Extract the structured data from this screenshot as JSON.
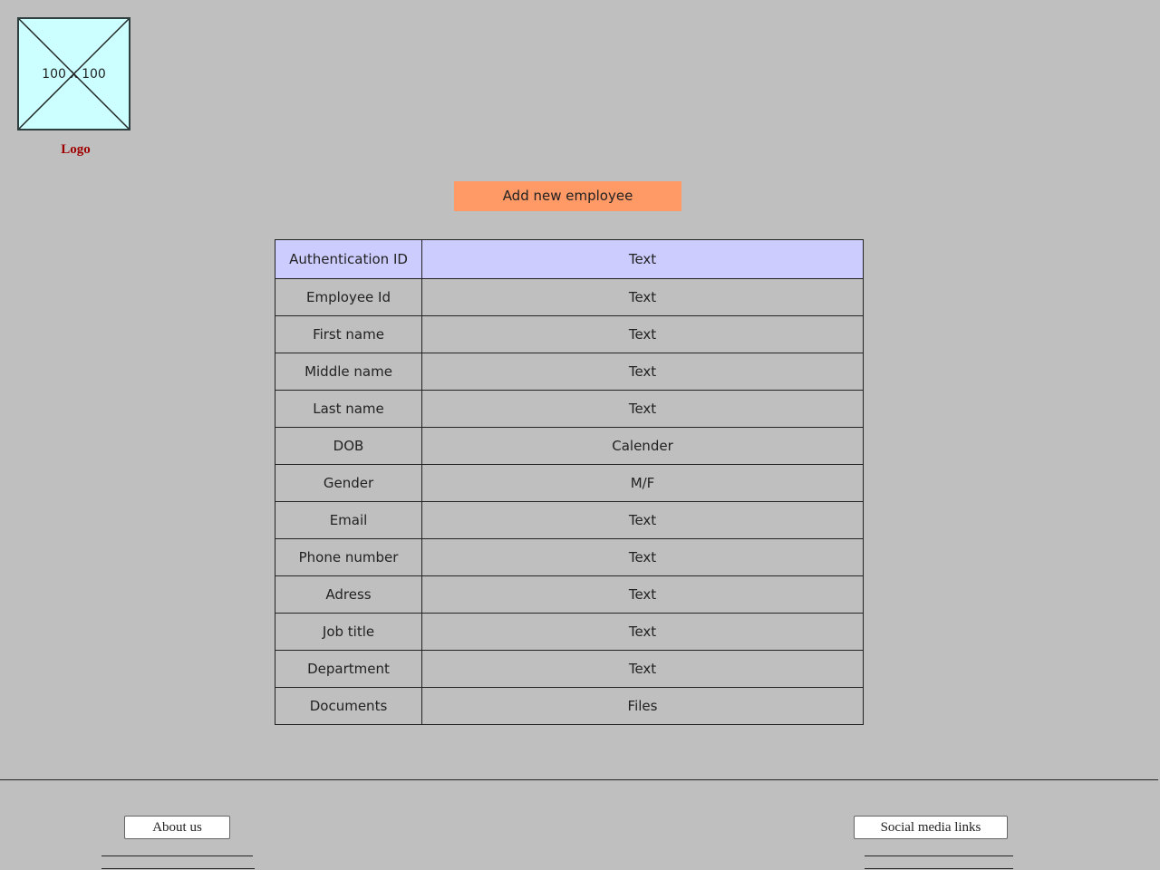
{
  "logo": {
    "placeholder_text": "100 x 100",
    "caption": "Logo"
  },
  "actions": {
    "add_employee_label": "Add new employee"
  },
  "form": {
    "header": {
      "field": "Authentication ID",
      "type": "Text"
    },
    "rows": [
      {
        "field": "Employee Id",
        "type": "Text"
      },
      {
        "field": "First name",
        "type": "Text"
      },
      {
        "field": "Middle name",
        "type": "Text"
      },
      {
        "field": "Last name",
        "type": "Text"
      },
      {
        "field": "DOB",
        "type": "Calender"
      },
      {
        "field": "Gender",
        "type": "M/F"
      },
      {
        "field": "Email",
        "type": "Text"
      },
      {
        "field": "Phone number",
        "type": "Text"
      },
      {
        "field": "Adress",
        "type": "Text"
      },
      {
        "field": "Job title",
        "type": "Text"
      },
      {
        "field": "Department",
        "type": "Text"
      },
      {
        "field": "Documents",
        "type": "Files"
      }
    ]
  },
  "footer": {
    "about_label": "About us",
    "social_label": "Social media links"
  },
  "colors": {
    "background": "#bfbfbf",
    "logo_fill": "#ccffff",
    "logo_caption": "#a00000",
    "add_button": "#ff9966",
    "table_header": "#ccccff"
  }
}
